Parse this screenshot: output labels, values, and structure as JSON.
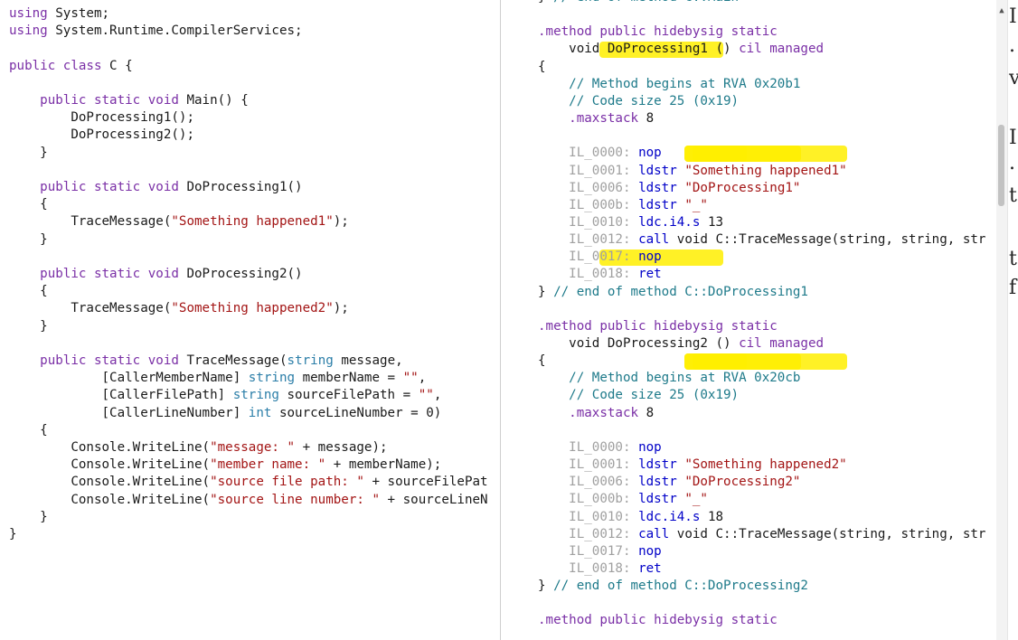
{
  "left_pane": {
    "lines": [
      "using System;",
      "using System.Runtime.CompilerServices;",
      "",
      "public class C {",
      "",
      "    public static void Main() {",
      "        DoProcessing1();",
      "        DoProcessing2();",
      "    }",
      "",
      "    public static void DoProcessing1()",
      "    {",
      "        TraceMessage(\"Something happened1\");",
      "    }",
      "",
      "    public static void DoProcessing2()",
      "    {",
      "        TraceMessage(\"Something happened2\");",
      "    }",
      "",
      "    public static void TraceMessage(string message,",
      "            [CallerMemberName] string memberName = \"\",",
      "            [CallerFilePath] string sourceFilePath = \"\",",
      "            [CallerLineNumber] int sourceLineNumber = 0)",
      "    {",
      "        Console.WriteLine(\"message: \" + message);",
      "        Console.WriteLine(\"member name: \" + memberName);",
      "        Console.WriteLine(\"source file path: \" + sourceFilePat",
      "        Console.WriteLine(\"source line number: \" + sourceLineN",
      "    }",
      "}"
    ]
  },
  "right_pane": {
    "lines": [
      "} // end of method C::Main",
      "",
      ".method public hidebysig static",
      "    void DoProcessing1 () cil managed",
      "{",
      "    // Method begins at RVA 0x20b1",
      "    // Code size 25 (0x19)",
      "    .maxstack 8",
      "",
      "    IL_0000: nop",
      "    IL_0001: ldstr \"Something happened1\"",
      "    IL_0006: ldstr \"DoProcessing1\"",
      "    IL_000b: ldstr \"_\"",
      "    IL_0010: ldc.i4.s 13",
      "    IL_0012: call void C::TraceMessage(string, string, str",
      "    IL_0017: nop",
      "    IL_0018: ret",
      "} // end of method C::DoProcessing1",
      "",
      ".method public hidebysig static",
      "    void DoProcessing2 () cil managed",
      "{",
      "    // Method begins at RVA 0x20cb",
      "    // Code size 25 (0x19)",
      "    .maxstack 8",
      "",
      "    IL_0000: nop",
      "    IL_0001: ldstr \"Something happened2\"",
      "    IL_0006: ldstr \"DoProcessing2\"",
      "    IL_000b: ldstr \"_\"",
      "    IL_0010: ldc.i4.s 18",
      "    IL_0012: call void C::TraceMessage(string, string, str",
      "    IL_0017: nop",
      "    IL_0018: ret",
      "} // end of method C::DoProcessing2",
      "",
      ".method public hidebysig static"
    ]
  },
  "far_pane": {
    "chars": [
      "I",
      ".",
      "v",
      "I",
      ".",
      "t",
      "t",
      "f"
    ]
  },
  "colors": {
    "highlight": "#ffee00",
    "keyword": "#7a2fa6",
    "type": "#2b7ea8",
    "string": "#a31515",
    "comment": "#1e7a8a",
    "il_opcode": "#0000c8",
    "il_label": "#a0a0a0",
    "divider": "#cfcfcf",
    "accent_top": "#3b8ee8"
  }
}
